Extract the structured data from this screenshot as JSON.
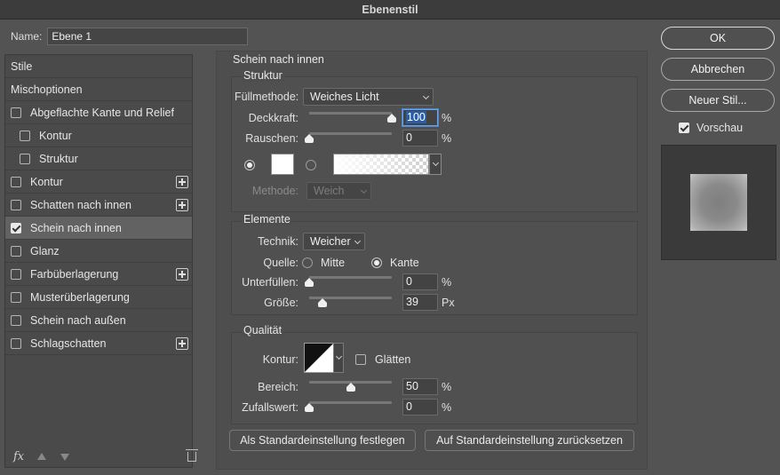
{
  "window": {
    "title": "Ebenenstil"
  },
  "name_field": {
    "label": "Name:",
    "value": "Ebene 1"
  },
  "styles_list": [
    {
      "label": "Stile",
      "checkbox": false,
      "checked": false,
      "plus": false,
      "indent": 0
    },
    {
      "label": "Mischoptionen",
      "checkbox": false,
      "checked": false,
      "plus": false,
      "indent": 0
    },
    {
      "label": "Abgeflachte Kante und Relief",
      "checkbox": true,
      "checked": false,
      "plus": false,
      "indent": 0
    },
    {
      "label": "Kontur",
      "checkbox": true,
      "checked": false,
      "plus": false,
      "indent": 1
    },
    {
      "label": "Struktur",
      "checkbox": true,
      "checked": false,
      "plus": false,
      "indent": 1
    },
    {
      "label": "Kontur",
      "checkbox": true,
      "checked": false,
      "plus": true,
      "indent": 0
    },
    {
      "label": "Schatten nach innen",
      "checkbox": true,
      "checked": false,
      "plus": true,
      "indent": 0
    },
    {
      "label": "Schein nach innen",
      "checkbox": true,
      "checked": true,
      "plus": false,
      "indent": 0,
      "selected": true
    },
    {
      "label": "Glanz",
      "checkbox": true,
      "checked": false,
      "plus": false,
      "indent": 0
    },
    {
      "label": "Farbüberlagerung",
      "checkbox": true,
      "checked": false,
      "plus": true,
      "indent": 0
    },
    {
      "label": "Musterüberlagerung",
      "checkbox": true,
      "checked": false,
      "plus": false,
      "indent": 0
    },
    {
      "label": "Schein nach außen",
      "checkbox": true,
      "checked": false,
      "plus": false,
      "indent": 0
    },
    {
      "label": "Schlagschatten",
      "checkbox": true,
      "checked": false,
      "plus": true,
      "indent": 0
    }
  ],
  "left_toolbar": {
    "fx_label": "fx"
  },
  "panel": {
    "title": "Schein nach innen",
    "structure": {
      "title": "Struktur",
      "blend_mode": {
        "label": "Füllmethode:",
        "value": "Weiches Licht"
      },
      "opacity": {
        "label": "Deckkraft:",
        "value": "100",
        "unit": "%",
        "level": 100
      },
      "noise": {
        "label": "Rauschen:",
        "value": "0",
        "unit": "%",
        "level": 0
      },
      "method": {
        "label": "Methode:",
        "value": "Weich"
      }
    },
    "elements": {
      "title": "Elemente",
      "technique": {
        "label": "Technik:",
        "value": "Weicher"
      },
      "source": {
        "label": "Quelle:",
        "option_center": "Mitte",
        "option_edge": "Kante",
        "selected": "Kante"
      },
      "choke": {
        "label": "Unterfüllen:",
        "value": "0",
        "unit": "%",
        "level": 0
      },
      "size": {
        "label": "Größe:",
        "value": "39",
        "unit": "Px",
        "level": 15.6
      }
    },
    "quality": {
      "title": "Qualität",
      "contour": {
        "label": "Kontur:",
        "antialias_label": "Glätten",
        "antialias_checked": false
      },
      "range": {
        "label": "Bereich:",
        "value": "50",
        "unit": "%",
        "level": 50
      },
      "jitter": {
        "label": "Zufallswert:",
        "value": "0",
        "unit": "%",
        "level": 0
      }
    },
    "buttons": {
      "make_default": "Als Standardeinstellung festlegen",
      "reset_default": "Auf Standardeinstellung zurücksetzen"
    }
  },
  "right": {
    "ok": "OK",
    "cancel": "Abbrechen",
    "new_style": "Neuer Stil...",
    "preview_label": "Vorschau",
    "preview_checked": true
  },
  "colors": {
    "glow_color": "#ffffff",
    "background": "#535353",
    "selected_row": "#626262",
    "focus_accent": "#4a86d4"
  }
}
